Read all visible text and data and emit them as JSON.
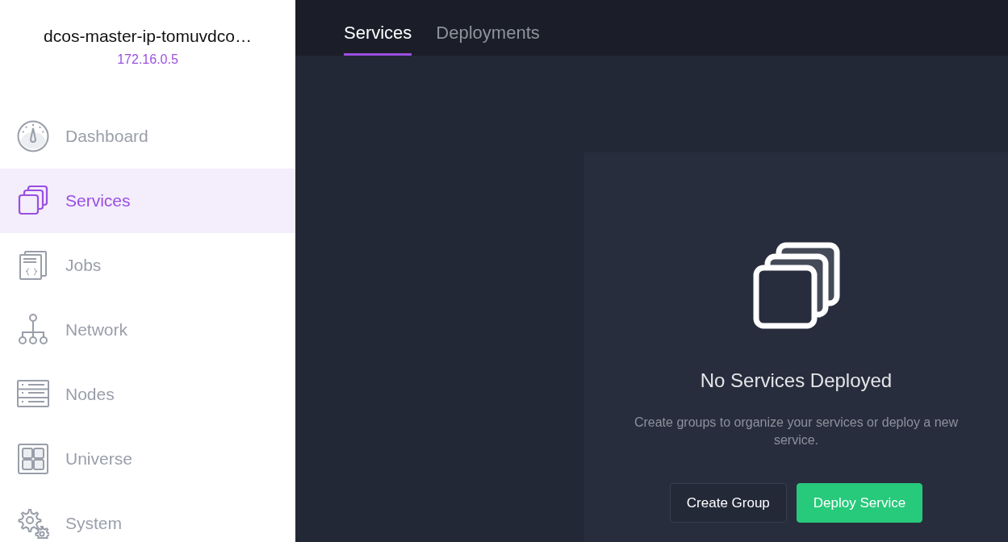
{
  "sidebar": {
    "cluster_name": "dcos-master-ip-tomuvdco…",
    "cluster_ip": "172.16.0.5",
    "items": [
      {
        "label": "Dashboard",
        "selected": false
      },
      {
        "label": "Services",
        "selected": true
      },
      {
        "label": "Jobs",
        "selected": false
      },
      {
        "label": "Network",
        "selected": false
      },
      {
        "label": "Nodes",
        "selected": false
      },
      {
        "label": "Universe",
        "selected": false
      },
      {
        "label": "System",
        "selected": false
      }
    ]
  },
  "tabs": [
    {
      "label": "Services",
      "selected": true
    },
    {
      "label": "Deployments",
      "selected": false
    }
  ],
  "empty_state": {
    "title": "No Services Deployed",
    "description": "Create groups to organize your services or deploy a new service.",
    "buttons": [
      {
        "label": "Create Group",
        "kind": "secondary"
      },
      {
        "label": "Deploy Service",
        "kind": "primary"
      }
    ]
  }
}
